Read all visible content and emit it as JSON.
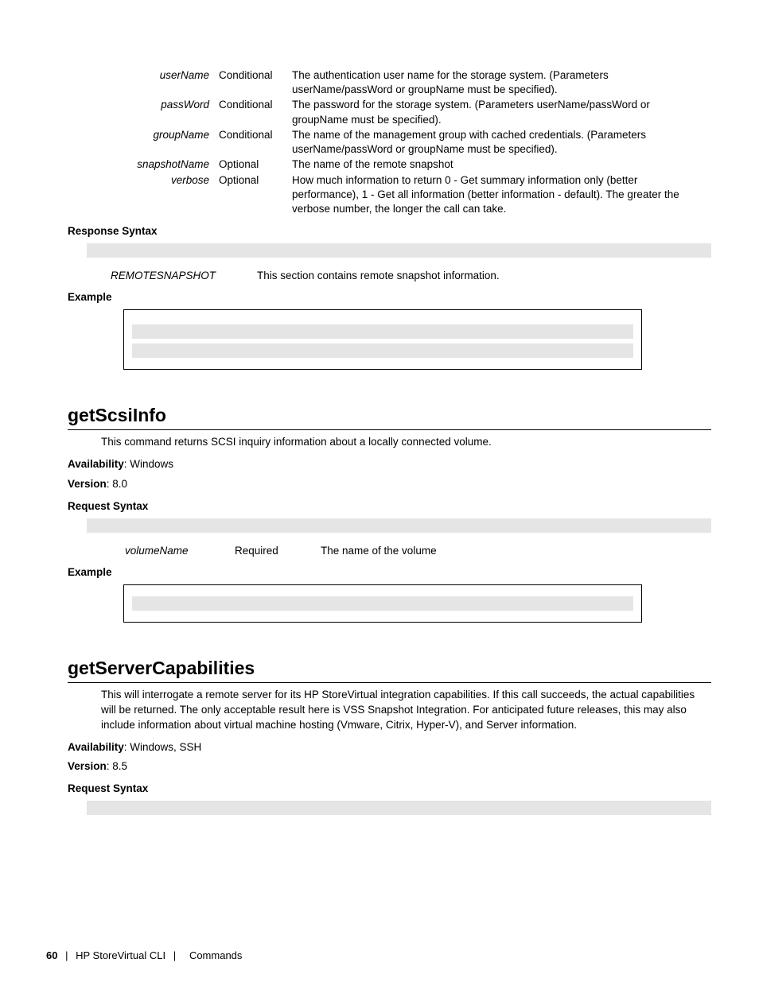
{
  "top_params": [
    {
      "name": "userName",
      "req": "Conditional",
      "desc": "The authentication user name for the storage system. (Parameters userName/passWord or groupName must be specified)."
    },
    {
      "name": "passWord",
      "req": "Conditional",
      "desc": "The password for the storage system. (Parameters userName/passWord or groupName must be specified)."
    },
    {
      "name": "groupName",
      "req": "Conditional",
      "desc": "The name of the management group with cached credentials. (Parameters userName/passWord or groupName must be specified)."
    },
    {
      "name": "snapshotName",
      "req": "Optional",
      "desc": "The name of the remote snapshot"
    },
    {
      "name": "verbose",
      "req": "Optional",
      "desc": "How much information to return 0 - Get summary information only (better performance), 1 - Get all information (better information - default). The greater the verbose number, the longer the call can take."
    }
  ],
  "headings": {
    "response_syntax": "Response Syntax",
    "example": "Example",
    "request_syntax": "Request Syntax",
    "availability": "Availability",
    "version": "Version"
  },
  "response": {
    "name": "REMOTESNAPSHOT",
    "desc": "This section contains remote snapshot information."
  },
  "section1": {
    "title": "getScsiInfo",
    "desc": "This command returns SCSI inquiry information about a locally connected volume.",
    "availability": ": Windows",
    "version": ": 8.0",
    "params": [
      {
        "name": "volumeName",
        "req": "Required",
        "desc": "The name of the volume"
      }
    ]
  },
  "section2": {
    "title": "getServerCapabilities",
    "desc": "This will interrogate a remote server for its HP StoreVirtual integration capabilities. If this call succeeds, the actual capabilities will be returned. The only acceptable result here is VSS Snapshot Integration. For anticipated future releases, this may also include information about virtual machine hosting (Vmware, Citrix, Hyper-V), and Server information.",
    "availability": ": Windows, SSH",
    "version": ": 8.5"
  },
  "footer": {
    "page": "60",
    "product": "HP StoreVirtual CLI",
    "section": "Commands"
  }
}
